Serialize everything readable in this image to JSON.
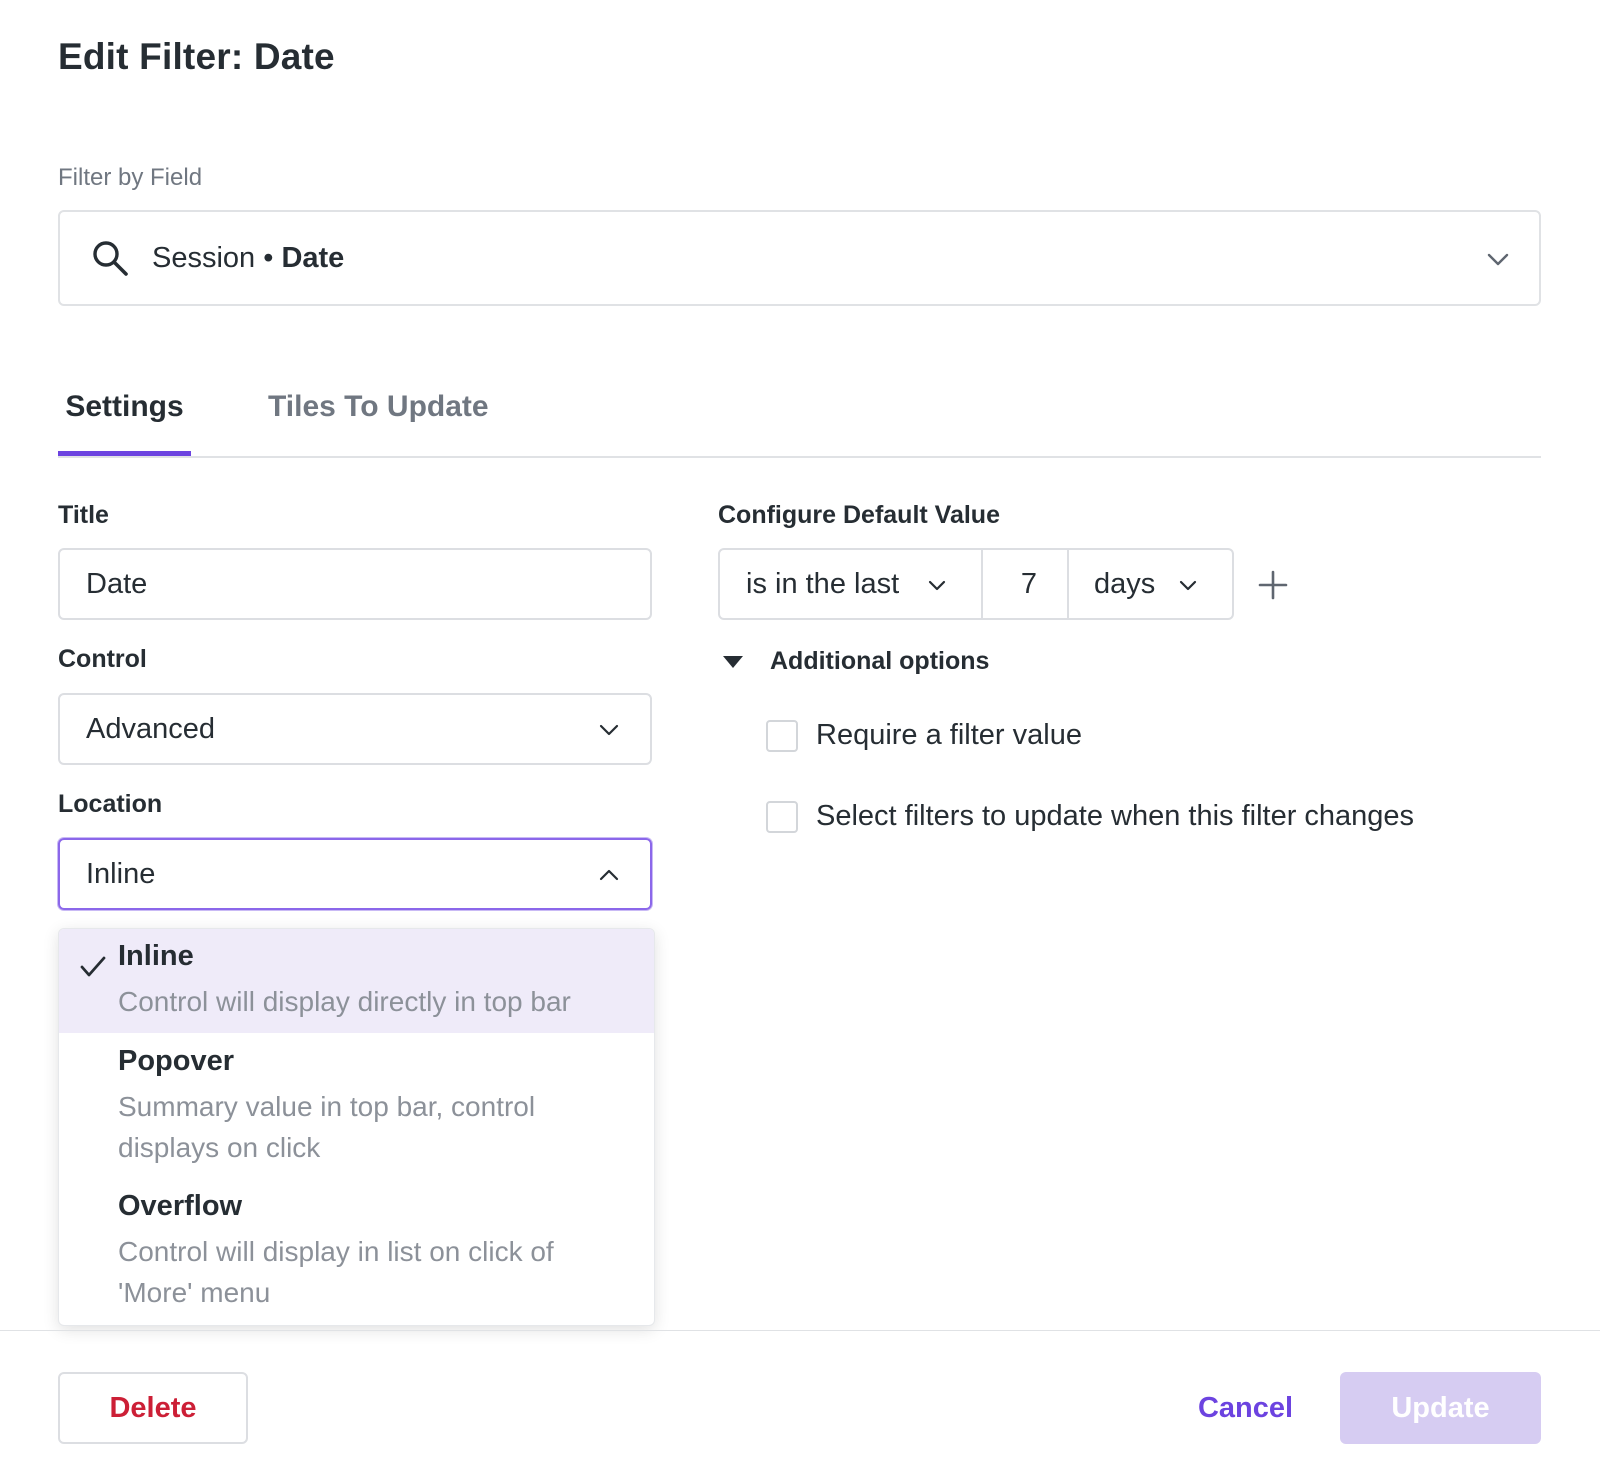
{
  "dialog": {
    "title": "Edit Filter: Date"
  },
  "filter_by_field": {
    "label": "Filter by Field",
    "value_prefix": "Session • ",
    "value_strong": "Date"
  },
  "tabs": [
    {
      "label": "Settings",
      "active": true
    },
    {
      "label": "Tiles To Update",
      "active": false
    }
  ],
  "settings": {
    "title_label": "Title",
    "title_value": "Date",
    "control_label": "Control",
    "control_value": "Advanced",
    "location_label": "Location",
    "location_value": "Inline",
    "location_options": [
      {
        "name": "Inline",
        "description": "Control will display directly in top bar",
        "selected": true
      },
      {
        "name": "Popover",
        "description": "Summary value in top bar, control displays on click",
        "selected": false
      },
      {
        "name": "Overflow",
        "description": "Control will display in list on click of 'More' menu",
        "selected": false
      }
    ]
  },
  "default_value": {
    "label": "Configure Default Value",
    "operator": "is in the last",
    "number": "7",
    "unit": "days"
  },
  "additional_options": {
    "label": "Additional options",
    "expanded": true,
    "checkboxes": [
      {
        "label": "Require a filter value",
        "checked": false
      },
      {
        "label": "Select filters to update when this filter changes",
        "checked": false
      }
    ]
  },
  "footer": {
    "delete_label": "Delete",
    "cancel_label": "Cancel",
    "update_label": "Update"
  },
  "colors": {
    "accent": "#6c43e0",
    "danger": "#cc1f36",
    "disabled_primary": "#d6ccf2",
    "selected_option_bg": "#efebf9"
  }
}
